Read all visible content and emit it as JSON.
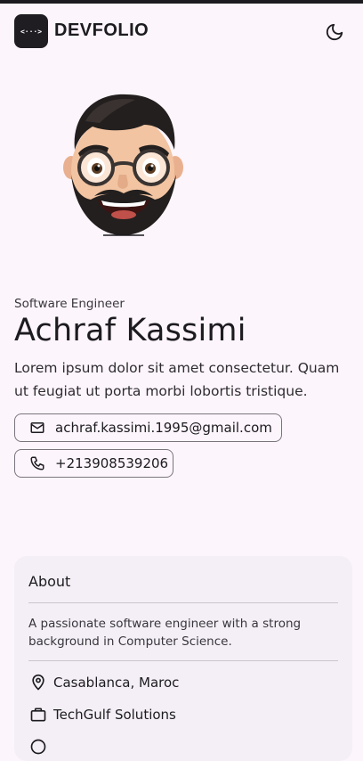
{
  "header": {
    "brand": "DEVFOLIO",
    "logo_glyph": "<···>",
    "logo_icon": "code-icon",
    "theme_icon": "moon-icon"
  },
  "profile": {
    "role": "Software Engineer",
    "name": "Achraf Kassimi",
    "bio": "Lorem ipsum dolor sit amet consectetur. Quam ut feugiat ut porta morbi lobortis tristique.",
    "email": "achraf.kassimi.1995@gmail.com",
    "phone": "+213908539206"
  },
  "about": {
    "title": "About",
    "description": "A passionate software engineer with a strong background in Computer Science.",
    "location": "Casablanca, Maroc",
    "company": "TechGulf Solutions"
  },
  "colors": {
    "background": "#fdf5fc",
    "card": "#f4eff6",
    "text": "#1c1b1f",
    "outline": "#79747e"
  }
}
